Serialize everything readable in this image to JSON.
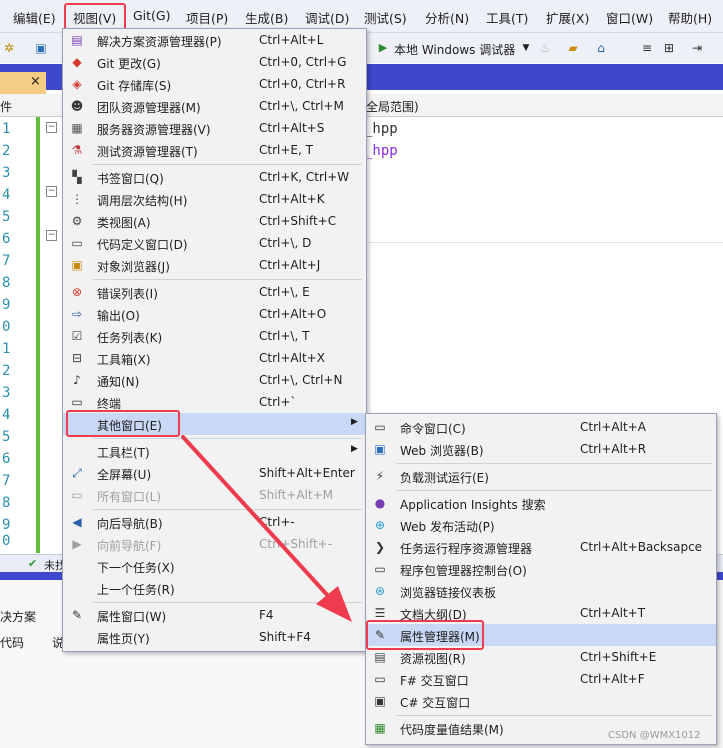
{
  "menubar": {
    "items": [
      "编辑(E)",
      "视图(V)",
      "Git(G)",
      "项目(P)",
      "生成(B)",
      "调试(D)",
      "测试(S)",
      "分析(N)",
      "工具(T)",
      "扩展(X)",
      "窗口(W)",
      "帮助(H)"
    ]
  },
  "toolbar": {
    "debug_target": "本地 Windows 调试器"
  },
  "doc_tab": {
    "close": "×"
  },
  "navbar": {
    "left": "件",
    "scope": "全局范围)"
  },
  "editor": {
    "line_numbers": [
      "1",
      "2",
      "3",
      "4",
      "5",
      "6",
      "7",
      "8",
      "9",
      "0",
      "1",
      "2",
      "3",
      "4",
      "5",
      "6",
      "7",
      "8",
      "9",
      "0",
      "1"
    ],
    "code_lines": [
      "_hpp",
      "_hpp"
    ]
  },
  "statusbar": {
    "text": "未找"
  },
  "bottom_panel": {
    "row1": "决方案",
    "row2_a": "代码",
    "row2_b": "说"
  },
  "view_menu": {
    "items": [
      {
        "label": "解决方案资源管理器(P)",
        "shortcut": "Ctrl+Alt+L",
        "icon": "solution-explorer-icon"
      },
      {
        "label": "Git 更改(G)",
        "shortcut": "Ctrl+0, Ctrl+G",
        "icon": "git-changes-icon"
      },
      {
        "label": "Git 存储库(S)",
        "shortcut": "Ctrl+0, Ctrl+R",
        "icon": "git-repo-icon"
      },
      {
        "label": "团队资源管理器(M)",
        "shortcut": "Ctrl+\\, Ctrl+M",
        "icon": "team-explorer-icon"
      },
      {
        "label": "服务器资源管理器(V)",
        "shortcut": "Ctrl+Alt+S",
        "icon": "server-explorer-icon"
      },
      {
        "label": "测试资源管理器(T)",
        "shortcut": "Ctrl+E, T",
        "icon": "test-explorer-icon"
      },
      {
        "label": "书签窗口(Q)",
        "shortcut": "Ctrl+K, Ctrl+W",
        "icon": "bookmark-icon"
      },
      {
        "label": "调用层次结构(H)",
        "shortcut": "Ctrl+Alt+K",
        "icon": "call-hierarchy-icon"
      },
      {
        "label": "类视图(A)",
        "shortcut": "Ctrl+Shift+C",
        "icon": "class-view-icon"
      },
      {
        "label": "代码定义窗口(D)",
        "shortcut": "Ctrl+\\, D",
        "icon": "code-definition-icon"
      },
      {
        "label": "对象浏览器(J)",
        "shortcut": "Ctrl+Alt+J",
        "icon": "object-browser-icon"
      },
      {
        "label": "错误列表(I)",
        "shortcut": "Ctrl+\\, E",
        "icon": "error-list-icon"
      },
      {
        "label": "输出(O)",
        "shortcut": "Ctrl+Alt+O",
        "icon": "output-icon"
      },
      {
        "label": "任务列表(K)",
        "shortcut": "Ctrl+\\, T",
        "icon": "task-list-icon"
      },
      {
        "label": "工具箱(X)",
        "shortcut": "Ctrl+Alt+X",
        "icon": "toolbox-icon"
      },
      {
        "label": "通知(N)",
        "shortcut": "Ctrl+\\, Ctrl+N",
        "icon": "bell-icon"
      },
      {
        "label": "终端",
        "shortcut": "Ctrl+`",
        "icon": "terminal-icon"
      },
      {
        "label": "其他窗口(E)",
        "shortcut": "",
        "icon": ""
      },
      {
        "label": "工具栏(T)",
        "shortcut": "",
        "icon": ""
      },
      {
        "label": "全屏幕(U)",
        "shortcut": "Shift+Alt+Enter",
        "icon": "fullscreen-icon"
      },
      {
        "label": "所有窗口(L)",
        "shortcut": "Shift+Alt+M",
        "icon": "all-windows-icon"
      },
      {
        "label": "向后导航(B)",
        "shortcut": "Ctrl+-",
        "icon": "navigate-back-icon"
      },
      {
        "label": "向前导航(F)",
        "shortcut": "Ctrl+Shift+-",
        "icon": "navigate-forward-icon"
      },
      {
        "label": "下一个任务(X)",
        "shortcut": "",
        "icon": ""
      },
      {
        "label": "上一个任务(R)",
        "shortcut": "",
        "icon": ""
      },
      {
        "label": "属性窗口(W)",
        "shortcut": "F4",
        "icon": "wrench-icon"
      },
      {
        "label": "属性页(Y)",
        "shortcut": "Shift+F4",
        "icon": ""
      }
    ]
  },
  "other_windows_menu": {
    "items": [
      {
        "label": "命令窗口(C)",
        "shortcut": "Ctrl+Alt+A",
        "icon": "command-window-icon"
      },
      {
        "label": "Web 浏览器(B)",
        "shortcut": "Ctrl+Alt+R",
        "icon": "web-browser-icon"
      },
      {
        "label": "负载测试运行(E)",
        "shortcut": "",
        "icon": "load-test-icon"
      },
      {
        "label": "Application Insights 搜索",
        "shortcut": "",
        "icon": "insights-icon"
      },
      {
        "label": "Web 发布活动(P)",
        "shortcut": "",
        "icon": "web-publish-icon"
      },
      {
        "label": "任务运行程序资源管理器",
        "shortcut": "Ctrl+Alt+Backsapce",
        "icon": "chevron-right-icon"
      },
      {
        "label": "程序包管理器控制台(O)",
        "shortcut": "",
        "icon": "package-console-icon"
      },
      {
        "label": "浏览器链接仪表板",
        "shortcut": "",
        "icon": "browser-link-icon"
      },
      {
        "label": "文档大纲(D)",
        "shortcut": "Ctrl+Alt+T",
        "icon": "document-outline-icon"
      },
      {
        "label": "属性管理器(M)",
        "shortcut": "",
        "icon": "wrench-icon"
      },
      {
        "label": "资源视图(R)",
        "shortcut": "Ctrl+Shift+E",
        "icon": "resource-view-icon"
      },
      {
        "label": "F# 交互窗口",
        "shortcut": "Ctrl+Alt+F",
        "icon": "fsharp-interactive-icon"
      },
      {
        "label": "C# 交互窗口",
        "shortcut": "",
        "icon": "csharp-interactive-icon"
      },
      {
        "label": "代码度量值结果(M)",
        "shortcut": "",
        "icon": "code-metrics-icon"
      }
    ]
  },
  "watermark": "CSDN @WMX1012"
}
